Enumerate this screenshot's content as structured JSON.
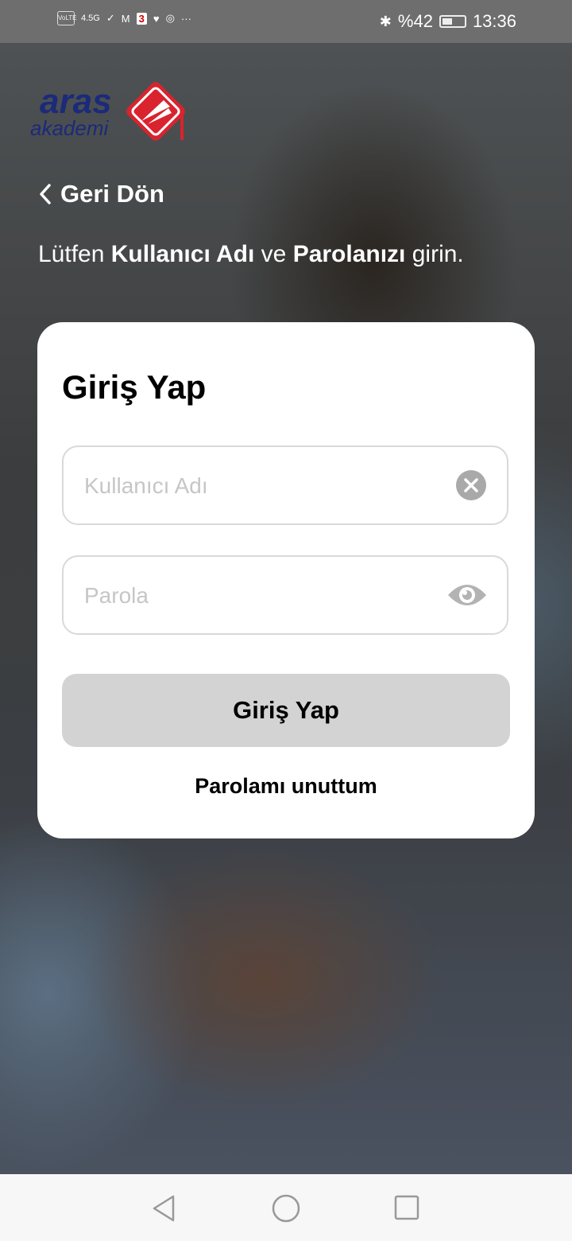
{
  "status_bar": {
    "left_icons": [
      "volte-icon",
      "signal-4.5g-icon",
      "check-icon",
      "gmail-icon",
      "app-3-icon",
      "health-icon",
      "app-icon",
      "more-icon"
    ],
    "volte": "VoLTE",
    "network": "4.5G",
    "more": "···",
    "battery_text": "%42",
    "time": "13:36"
  },
  "logo": {
    "line1": "aras",
    "line2": "akademi"
  },
  "back_label": "Geri Dön",
  "prompt": {
    "p1": "Lütfen ",
    "b1": "Kullanıcı Adı",
    "p2": " ve ",
    "b2": "Parolanızı",
    "p3": " girin."
  },
  "login_card": {
    "title": "Giriş Yap",
    "username_placeholder": "Kullanıcı Adı",
    "username_value": "",
    "password_placeholder": "Parola",
    "password_value": "",
    "submit_label": "Giriş Yap",
    "forgot_label": "Parolamı unuttum"
  },
  "colors": {
    "logo_blue": "#1b2a7a",
    "logo_red": "#d9232e",
    "button_bg": "#d3d3d3"
  }
}
